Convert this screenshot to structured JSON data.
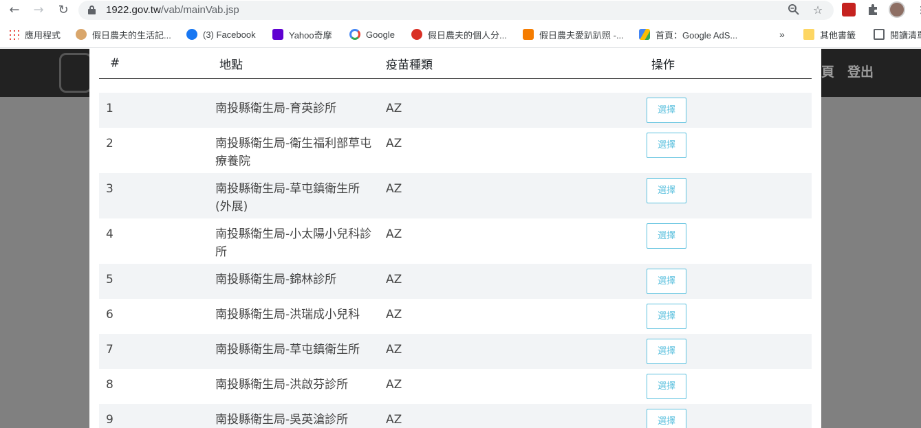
{
  "browser": {
    "url_host": "1922.gov.tw",
    "url_path": "/vab/mainVab.jsp",
    "bookmarks": [
      {
        "label": "應用程式",
        "color": "#e8453c"
      },
      {
        "label": "假日農夫的生活記...",
        "color": "#d9a66b"
      },
      {
        "label": "(3) Facebook",
        "color": "#1877f2"
      },
      {
        "label": "Yahoo奇摩",
        "color": "#5f01d1"
      },
      {
        "label": "Google",
        "color": "#4285f4"
      },
      {
        "label": "假日農夫的個人分...",
        "color": "#d93025"
      },
      {
        "label": "假日農夫愛趴趴照 -...",
        "color": "#f57c00"
      },
      {
        "label": "首頁：Google AdS...",
        "color": "#fbbc04"
      },
      {
        "label": "其他書籤",
        "color": "#fdd663"
      },
      {
        "label": "閱讀清單",
        "color": "#5f6368"
      }
    ],
    "overflow_label": "»"
  },
  "site": {
    "header_links": [
      "頁",
      "登出"
    ]
  },
  "table": {
    "headers": {
      "num": "#",
      "location": "地點",
      "vaccine": "疫苗種類",
      "action": "操作"
    },
    "button_label": "選擇",
    "rows": [
      {
        "num": "1",
        "location": "南投縣衛生局-育英診所",
        "vaccine": "AZ"
      },
      {
        "num": "2",
        "location": "南投縣衛生局-衛生福利部草屯療養院",
        "vaccine": "AZ"
      },
      {
        "num": "3",
        "location": "南投縣衛生局-草屯鎮衛生所(外展)",
        "vaccine": "AZ"
      },
      {
        "num": "4",
        "location": "南投縣衛生局-小太陽小兒科診所",
        "vaccine": "AZ"
      },
      {
        "num": "5",
        "location": "南投縣衛生局-錦林診所",
        "vaccine": "AZ"
      },
      {
        "num": "6",
        "location": "南投縣衛生局-洪瑞成小兒科",
        "vaccine": "AZ"
      },
      {
        "num": "7",
        "location": "南投縣衛生局-草屯鎮衛生所",
        "vaccine": "AZ"
      },
      {
        "num": "8",
        "location": "南投縣衛生局-洪啟芬診所",
        "vaccine": "AZ"
      },
      {
        "num": "9",
        "location": "南投縣衛生局-吳英滄診所",
        "vaccine": "AZ"
      }
    ]
  }
}
